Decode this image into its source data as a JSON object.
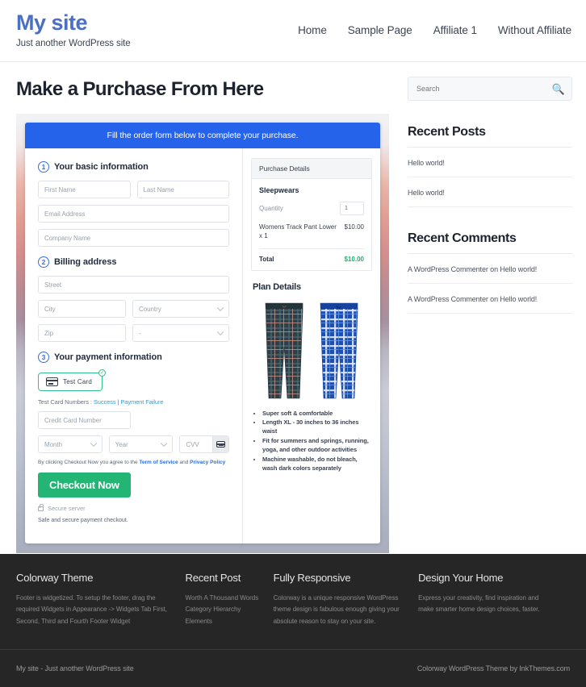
{
  "header": {
    "site_title": "My site",
    "tagline": "Just another WordPress site",
    "nav": [
      {
        "label": "Home"
      },
      {
        "label": "Sample Page"
      },
      {
        "label": "Affiliate 1"
      },
      {
        "label": "Without Affiliate"
      }
    ]
  },
  "main": {
    "page_title": "Make a Purchase From Here",
    "banner": "Fill the order form below to complete your purchase.",
    "steps": {
      "one_num": "1",
      "one_title": "Your basic information",
      "two_num": "2",
      "two_title": "Billing address",
      "three_num": "3",
      "three_title": "Your payment information"
    },
    "fields": {
      "first_name": "First Name",
      "last_name": "Last Name",
      "email": "Email Address",
      "company": "Company Name",
      "street": "Street",
      "city": "City",
      "country": "Country",
      "zip": "Zip",
      "state": "-",
      "credit_card": "Credit Card Number",
      "month": "Month",
      "year": "Year",
      "cvv": "CVV"
    },
    "payment": {
      "card_option_label": "Test Card",
      "check_glyph": "✓",
      "test_numbers_prefix": "Test Card Numbers : ",
      "test_success": "Success",
      "test_divider": " | ",
      "test_failure": "Payment Failure",
      "terms_prefix": "By clicking Checkout Now you agree to the ",
      "terms_link": "Term of Service",
      "terms_mid": " and ",
      "privacy_link": "Privacy Policy",
      "checkout_label": "Checkout Now",
      "secure_server": "Secure server",
      "safe_text": "Safe and secure payment checkout."
    },
    "purchase_details": {
      "heading": "Purchase Details",
      "product": "Sleepwears",
      "quantity_label": "Quantity",
      "quantity_value": "1",
      "line_item": "Womens Track Pant Lower x 1",
      "line_price": "$10.00",
      "total_label": "Total",
      "total_value": "$10.00"
    },
    "plan": {
      "title": "Plan Details",
      "features": [
        "Super soft & comfortable",
        "Length XL - 30 inches to 36 inches waist",
        "Fit for summers and springs, running, yoga, and other outdoor activities",
        "Machine washable, do not bleach, wash dark colors separately"
      ]
    }
  },
  "sidebar": {
    "search_placeholder": "Search",
    "search_icon": "search-icon",
    "recent_posts_title": "Recent Posts",
    "recent_posts": [
      {
        "label": "Hello world!"
      },
      {
        "label": "Hello world!"
      }
    ],
    "recent_comments_title": "Recent Comments",
    "recent_comments": [
      {
        "label": "A WordPress Commenter on Hello world!"
      },
      {
        "label": "A WordPress Commenter on Hello world!"
      }
    ]
  },
  "footer": {
    "columns": [
      {
        "title": "Colorway Theme",
        "text": "Footer is widgetized. To setup the footer, drag the required Widgets in Appearance -> Widgets Tab First, Second, Third and Fourth Footer Widget",
        "items": []
      },
      {
        "title": "Recent Post",
        "text": "",
        "items": [
          {
            "label": "Worth A Thousand Words"
          },
          {
            "label": "Category Hierarchy"
          },
          {
            "label": "Elements"
          }
        ]
      },
      {
        "title": "Fully Responsive",
        "text": "Colorway is a unique responsive WordPress theme design is fabulous enough giving your absolute reason to stay on your site.",
        "items": []
      },
      {
        "title": "Design Your Home",
        "text": "Express your creativity, find inspiration and make smarter home design choices, faster.",
        "items": []
      }
    ],
    "left_text": "My site - Just another WordPress site",
    "right_text": "Colorway WordPress Theme by InkThemes.com"
  },
  "colors": {
    "brand_blue": "#4a6fc3",
    "banner_blue": "#2563eb",
    "accent_green": "#22b573",
    "total_green": "#1bb76e",
    "footer_dark": "#262626"
  }
}
